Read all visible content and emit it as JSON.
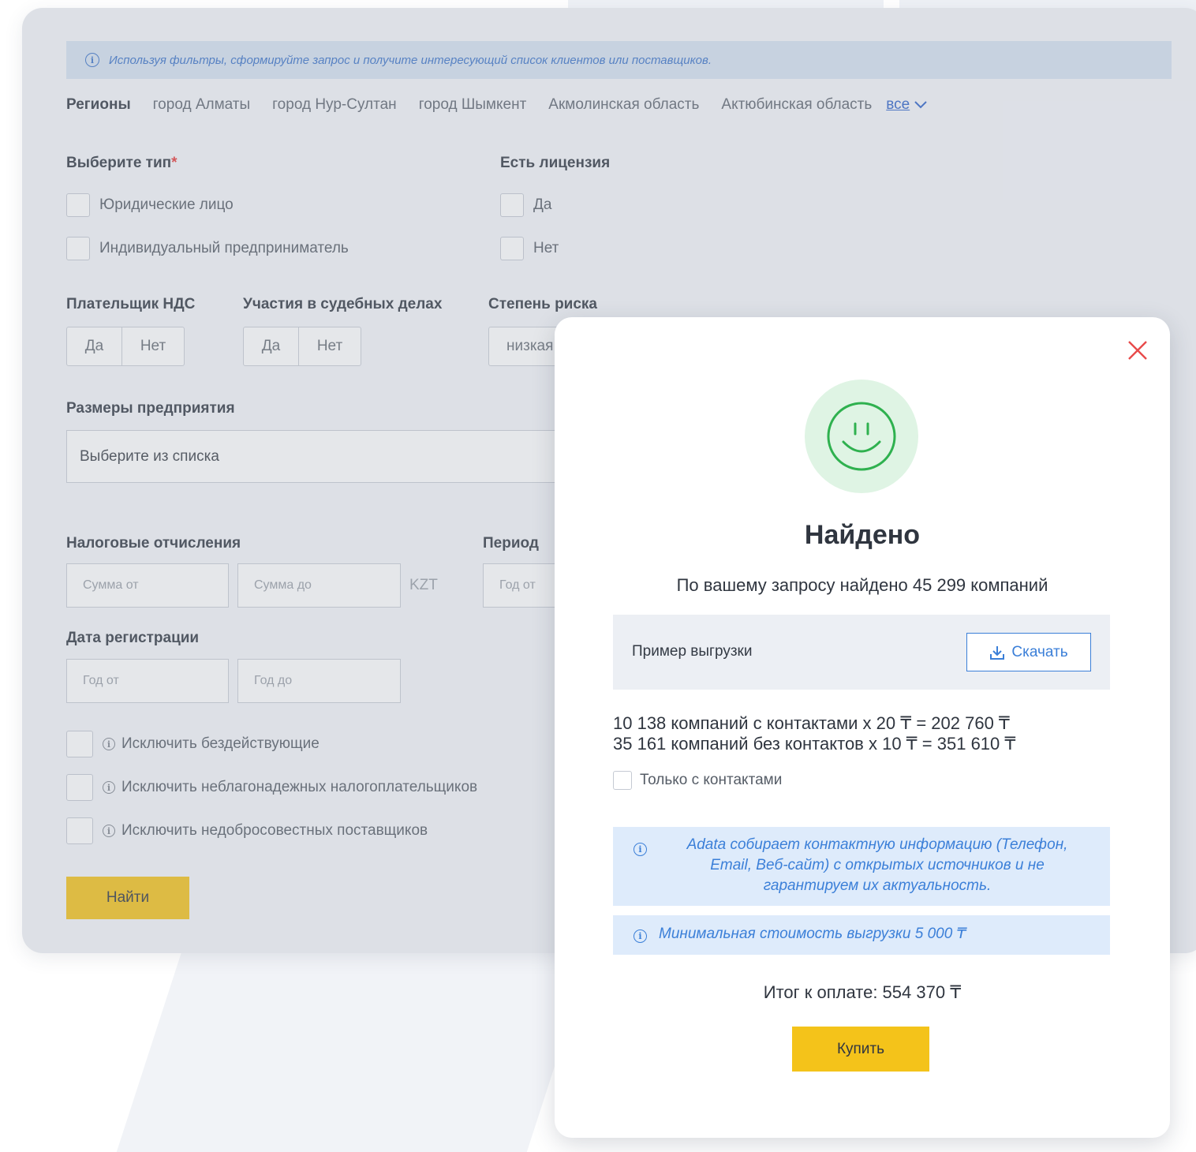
{
  "info_bar": {
    "text": "Используя фильтры, сформируйте запрос и получите интересующий список клиентов или поставщиков."
  },
  "regions": {
    "label": "Регионы",
    "items": [
      "город Алматы",
      "город Нур-Султан",
      "город Шымкент",
      "Акмолинская область",
      "Актюбинская область"
    ],
    "all_label": "все"
  },
  "type_filter": {
    "label": "Выберите тип",
    "required_mark": "*",
    "options": [
      "Юридические лицо",
      "Индивидуальный предприниматель"
    ]
  },
  "license_filter": {
    "label": "Есть лицензия",
    "options": [
      "Да",
      "Нет"
    ]
  },
  "vat_filter": {
    "label": "Плательщик НДС",
    "options": [
      "Да",
      "Нет"
    ]
  },
  "court_filter": {
    "label": "Участия в судебных делах",
    "options": [
      "Да",
      "Нет"
    ]
  },
  "risk_filter": {
    "label": "Степень риска",
    "value": "низкая"
  },
  "size_filter": {
    "label": "Размеры предприятия",
    "placeholder": "Выберите из списка"
  },
  "tax_filter": {
    "label": "Налоговые отчисления",
    "from_placeholder": "Сумма от",
    "to_placeholder": "Сумма до",
    "currency": "KZT"
  },
  "period_filter": {
    "label": "Период",
    "from_placeholder": "Год от"
  },
  "reg_date_filter": {
    "label": "Дата регистрации",
    "from_placeholder": "Год от",
    "to_placeholder": "Год до"
  },
  "exclusions": [
    "Исключить бездействующие",
    "Исключить неблагонадежных налогоплательщиков",
    "Исключить недобросовестных поставщиков"
  ],
  "find_button": "Найти",
  "modal": {
    "title": "Найдено",
    "subtitle": "По вашему запросу найдено 45 299 компаний",
    "sample_label": "Пример выгрузки",
    "download_label": "Скачать",
    "line_with_contacts": "10 138 компаний с контактами x 20 ₸ = 202 760 ₸",
    "line_without_contacts": "35 161 компаний без контактов x 10 ₸ = 351 610 ₸",
    "only_contacts_label": "Только с контактами",
    "note_contacts": "Adata собирает контактную информацию (Телефон, Email, Веб-сайт) с открытых источников и не гарантируем их актуальность.",
    "note_min_cost": "Минимальная стоимость выгрузки 5 000 ₸",
    "total": "Итог к оплате: 554 370 ₸",
    "buy_button": "Купить"
  },
  "colors": {
    "accent_yellow": "#f4c31a",
    "link_blue": "#3b7fd8",
    "success_green": "#2fb14f",
    "close_red": "#e84a4a"
  }
}
